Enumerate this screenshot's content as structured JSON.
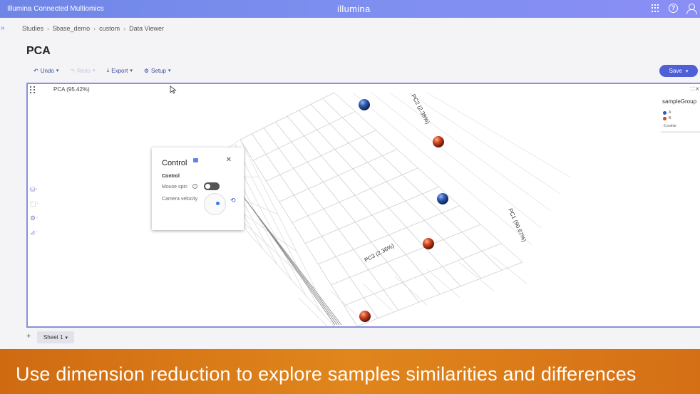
{
  "topbar": {
    "app_name": "Illumina Connected Multiomics",
    "brand": "illumina"
  },
  "breadcrumb": [
    "Studies",
    "5base_demo",
    "custom",
    "Data Viewer"
  ],
  "page": {
    "title": "PCA"
  },
  "toolbar": {
    "undo": "Undo",
    "redo": "Redo",
    "export": "Export",
    "setup": "Setup",
    "save": "Save"
  },
  "plot": {
    "title": "PCA (95.42%)",
    "axis_pc1": "PC1 (90.67%)",
    "axis_pc2": "PC2 (2.38%)",
    "axis_pc3": "PC3 (2.36%)"
  },
  "legend": {
    "title": "sampleGroup",
    "items": [
      {
        "label": "A",
        "color": "#2f5bb5"
      },
      {
        "label": "B",
        "color": "#d2451e"
      }
    ],
    "count": "6 points"
  },
  "control_panel": {
    "title": "Control",
    "section": "Control",
    "mouse_spin_label": "Mouse spin",
    "mouse_spin_on": false,
    "camera_velocity_label": "Camera velocity"
  },
  "sheets": {
    "active": "Sheet 1"
  },
  "caption": "Use dimension reduction to explore samples similarities and differences",
  "colors": {
    "accent": "#4f5fd8",
    "group_a": "#2f5bb5",
    "group_b": "#d2451e"
  }
}
